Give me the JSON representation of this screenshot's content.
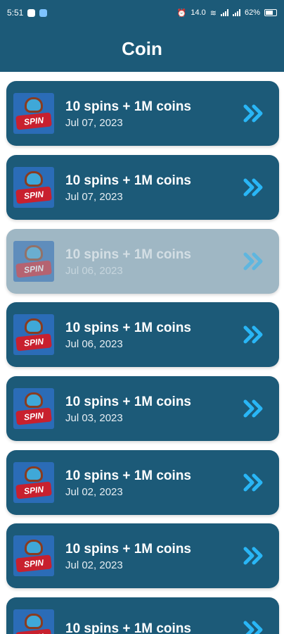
{
  "status": {
    "time": "5:51",
    "speed": "14.0",
    "battery": "62%"
  },
  "header": {
    "title": "Coin"
  },
  "thumb_label": "SPIN",
  "items": [
    {
      "title": "10 spins + 1M coins",
      "date": "Jul 07, 2023"
    },
    {
      "title": "10 spins + 1M coins",
      "date": "Jul 07, 2023"
    },
    {
      "title": "10 spins + 1M coins",
      "date": "Jul 06, 2023"
    },
    {
      "title": "10 spins + 1M coins",
      "date": "Jul 06, 2023"
    },
    {
      "title": "10 spins + 1M coins",
      "date": "Jul 03, 2023"
    },
    {
      "title": "10 spins + 1M coins",
      "date": "Jul 02, 2023"
    },
    {
      "title": "10 spins + 1M coins",
      "date": "Jul 02, 2023"
    },
    {
      "title": "10 spins + 1M coins",
      "date": ""
    }
  ],
  "colors": {
    "primary": "#1c5a78",
    "arrow": "#29b6f6",
    "faded": "#9fb7c4"
  }
}
